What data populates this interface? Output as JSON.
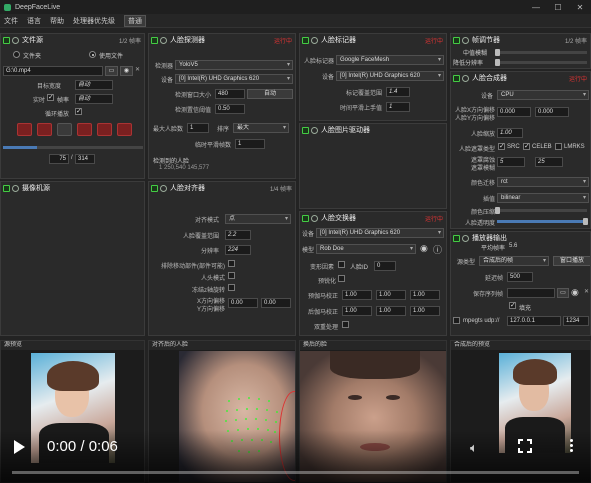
{
  "app": {
    "title": "DeepFaceLive",
    "window_buttons": [
      "—",
      "☐",
      "✕"
    ]
  },
  "menu": {
    "items": [
      "文件",
      "语言",
      "帮助"
    ],
    "process_label": "处理器优先级",
    "process_value": "普通"
  },
  "file_source": {
    "title": "文件源",
    "fps": "1/2 帧率",
    "radio_folder": "文件夹",
    "radio_file": "使用文件",
    "path": "G:\\0.mp4",
    "target_width_label": "目标宽度",
    "target_width": "自动",
    "realtime_label": "实时",
    "frame_label": "帧率",
    "fps_value": "自动",
    "loop_label": "循环播放",
    "frame_pos": "75",
    "frame_total": "314",
    "progress": 0.24
  },
  "face_detector": {
    "title": "人脸探测器",
    "status": "运行中",
    "detector_label": "检测器",
    "detector_value": "YoloV5",
    "device_label": "设备",
    "device_value": "[0] Intel(R) UHD Graphics 620",
    "window_size_label": "检测窗口大小",
    "window_size": "480",
    "auto_label": "自动",
    "threshold_label": "检测置信阈值",
    "threshold": "0.50",
    "max_faces_label": "最大人脸数",
    "max_faces": "1",
    "sort_label": "排序",
    "sort_value": "最大",
    "temporal_label": "临时平滑帧数",
    "temporal": "1",
    "detected_label": "检测到的人脸",
    "detected_value": "1 250,540 145,577"
  },
  "face_marker": {
    "title": "人脸标记器",
    "status": "运行中",
    "marker_label": "人脸标记器",
    "marker_value": "Google FaceMesh",
    "device_label": "设备",
    "device_value": "[0] Intel(R) UHD Graphics 620",
    "coverage_label": "标记覆盖范围",
    "coverage": "1.4",
    "temporal_label": "时间平滑上手值",
    "temporal": "1"
  },
  "face_aligner": {
    "title": "人脸对齐器",
    "status": "1/4 帧率",
    "mode_label": "对齐模式",
    "mode_value": "点",
    "coverage_label": "人脸覆盖范围",
    "coverage": "2.2",
    "resolution_label": "分辨率",
    "resolution": "224",
    "exclude_moving_label": "排除移动部件(部件可能)",
    "head_mode_label": "人头模式",
    "freeze_label": "冻结z轴旋转",
    "x_offset_label": "X方向偏移",
    "y_offset_label": "Y方向偏移",
    "x_offset": "0.00",
    "y_offset": "0.00"
  },
  "face_animator": {
    "title": "人脸图片驱动器"
  },
  "face_swapper": {
    "title": "人脸交换器",
    "status": "运行中",
    "device_label": "设备",
    "device_value": "[0] Intel(R) UHD Graphics 620",
    "model_label": "模型",
    "model_value": "Rob Doe",
    "morph_label": "变形因素",
    "swap_all_label": "人脸ID",
    "face_id": "0",
    "pre_sharpen_label": "预锐化",
    "pre_gamma_label": "预伽马校正",
    "post_gamma_label": "后伽马校正",
    "gamma_values": [
      "1.00",
      "1.00",
      "1.00",
      "1.00",
      "1.00",
      "1.00"
    ],
    "two_pass_label": "双重处理"
  },
  "frame_adjuster": {
    "title": "帧调节器",
    "status": "1/2 帧率",
    "median_label": "中值模糊",
    "degrade_label": "降低分辨率"
  },
  "face_merger": {
    "title": "人脸合成器",
    "status": "运行中",
    "device_label": "设备",
    "device_value": "CPU",
    "x_offset_label": "人脸X方向偏移",
    "y_offset_label": "人脸Y方向偏移",
    "x_offset": "0.000",
    "y_offset": "0.000",
    "scale_label": "人脸缩放",
    "scale": "1.00",
    "mask_type_label": "人脸遮罩类型",
    "mask_src": "SRC",
    "mask_celeb": "CELEB",
    "mask_lmrks": "LMRKS",
    "erode_label": "遮罩腐蚀",
    "blur_label": "遮罩模糊",
    "erode": "5",
    "blur": "25",
    "color_transfer_label": "颜色迁移",
    "color_transfer": "rct",
    "interp_label": "插值",
    "interp": "bilinear",
    "opacity_label": "颜色压缩",
    "face_opacity_label": "人脸透明度"
  },
  "stream_output": {
    "title": "播放器输出",
    "avg_fps_label": "平均帧率",
    "avg_fps": "5.6",
    "source_type_label": "源类型",
    "source_type": "合成后的帧",
    "source_btn": "窗口播放",
    "delay_label": "延迟帧",
    "delay": "500",
    "save_path_label": "保存序列帧",
    "fill_label": "填充",
    "mpegts_label": "mpegts udp://",
    "mpegts_host": "127.0.0.1",
    "mpegts_port": "1234"
  },
  "camera": {
    "title": "摄像机源"
  },
  "previews": {
    "source": "源预览",
    "aligned": "对齐后的人脸",
    "swapped": "换后的脸",
    "merged": "合成后的预览"
  },
  "video": {
    "time": "0:00 / 0:06",
    "progress": 0
  }
}
